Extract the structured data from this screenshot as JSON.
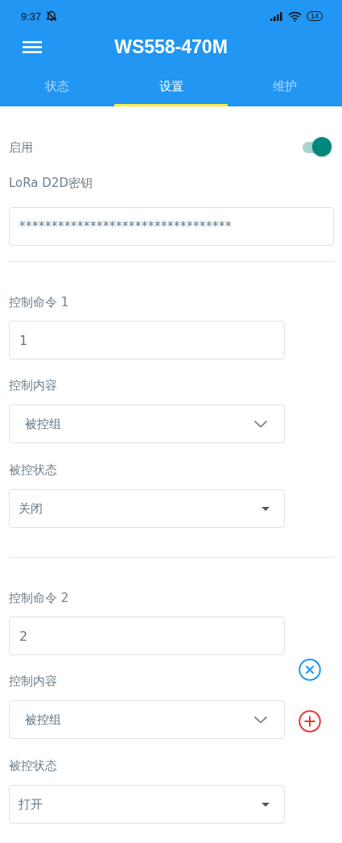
{
  "status_bar": {
    "time": "9:37",
    "battery": "14"
  },
  "app_bar": {
    "title": "WS558-470M"
  },
  "tabs": [
    {
      "label": "状态",
      "selected": false
    },
    {
      "label": "设置",
      "selected": true
    },
    {
      "label": "维护",
      "selected": false
    }
  ],
  "enable": {
    "label": "启用",
    "on": true
  },
  "key_field": {
    "label": "LoRa D2D密钥",
    "value": "*********************************"
  },
  "commands": [
    {
      "label": "控制命令 1",
      "value": "1",
      "removable": false,
      "addable": false,
      "fields": [
        {
          "label": "控制内容",
          "value": "被控组",
          "kind": "chevron"
        },
        {
          "label": "被控状态",
          "value": "关闭",
          "kind": "triangle"
        }
      ]
    },
    {
      "label": "控制命令 2",
      "value": "2",
      "removable": true,
      "addable": true,
      "fields": [
        {
          "label": "控制内容",
          "value": "被控组",
          "kind": "chevron"
        },
        {
          "label": "被控状态",
          "value": "打开",
          "kind": "triangle"
        }
      ]
    }
  ]
}
